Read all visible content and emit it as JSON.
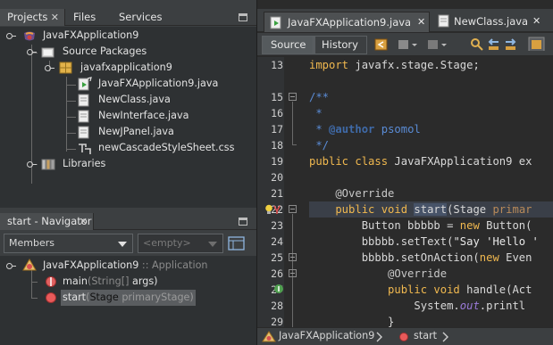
{
  "projects_panel": {
    "tabs": [
      {
        "label": "Projects",
        "close": "✕"
      },
      {
        "label": "Files"
      },
      {
        "label": "Services"
      }
    ],
    "tree": [
      {
        "label": "JavaFXApplication9"
      },
      {
        "label": "Source Packages"
      },
      {
        "label": "javafxapplication9"
      },
      {
        "label": "JavaFXApplication9.java"
      },
      {
        "label": "NewClass.java"
      },
      {
        "label": "NewInterface.java"
      },
      {
        "label": "NewJPanel.java"
      },
      {
        "label": "newCascadeStyleSheet.css"
      },
      {
        "label": "Libraries"
      }
    ]
  },
  "navigator_panel": {
    "title": "start - Navigator",
    "close": "✕",
    "members_combo": "Members",
    "filter_combo": "<empty>",
    "tree": {
      "class_name": "JavaFXApplication9",
      "class_suffix": ":: Application",
      "members": [
        {
          "name": "main",
          "params_type": "(String[]",
          "params_rest": " args)"
        },
        {
          "name": "start",
          "params_open": "(",
          "params_type": "Stage",
          "params_rest": " primaryStage)"
        }
      ]
    }
  },
  "editor": {
    "tabs": [
      {
        "label": "JavaFXApplication9.java",
        "close": "✕"
      },
      {
        "label": "NewClass.java",
        "close": "✕"
      }
    ],
    "toolbar": {
      "source": "Source",
      "history": "History"
    },
    "line_numbers": [
      "13",
      "15",
      "16",
      "17",
      "18",
      "19",
      "20",
      "21",
      "22",
      "23",
      "24",
      "25",
      "26",
      "27",
      "28",
      "29"
    ],
    "code": {
      "l13a": "import",
      "l13b": " javafx.stage.Stage;",
      "l15": "/**",
      "l16": " *",
      "l17a": " * ",
      "l17b": "@author",
      "l17c": " psomol",
      "l18": " */",
      "l19a": "public class",
      "l19b": " JavaFXApplication9 ex",
      "l21": "    @Override",
      "l22a": "    public void",
      "l22b": " ",
      "l22c": "start",
      "l22d": "(Stage ",
      "l22e": "primar",
      "l23a": "        Button bbbbb = ",
      "l23b": "new",
      "l23c": " Button(",
      "l24a": "        bbbbb.setText(",
      "l24b": "\"Say 'Hello '",
      "l25a": "        bbbbb.setOnAction(",
      "l25b": "new",
      "l25c": " Even",
      "l26": "            @Override",
      "l27a": "            public void",
      "l27b": " handle(Act",
      "l28a": "                System.",
      "l28b": "out",
      "l28c": ".printl",
      "l29": "            }"
    },
    "breadcrumb": [
      {
        "label": "JavaFXApplication9"
      },
      {
        "label": "start"
      }
    ]
  }
}
